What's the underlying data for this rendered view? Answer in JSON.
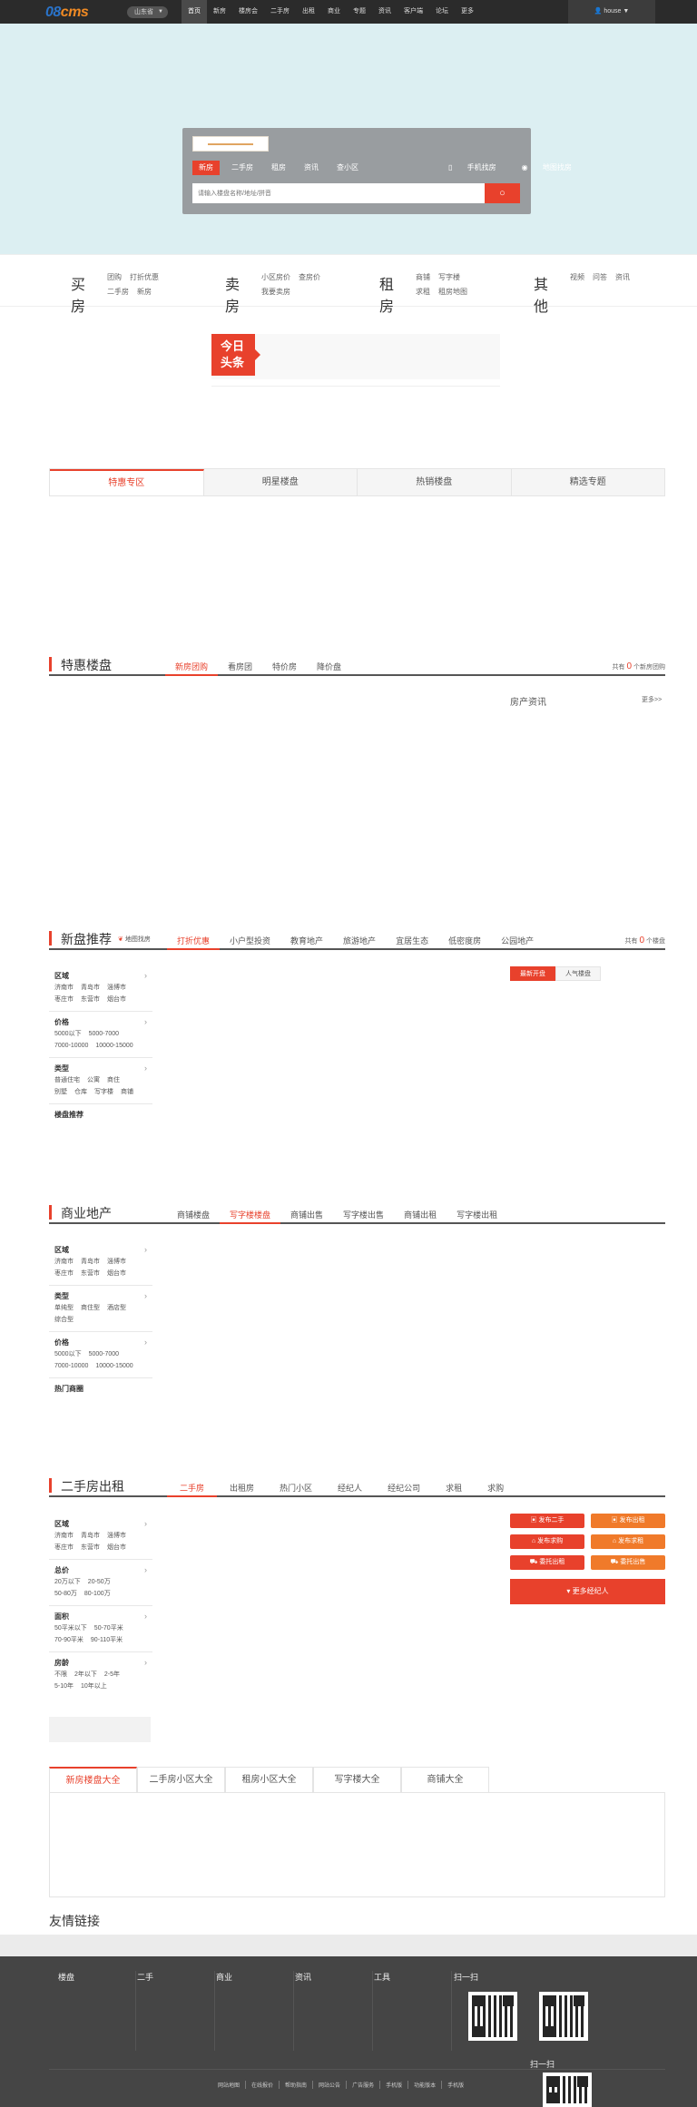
{
  "topbar": {
    "logo_num": "08",
    "logo_text": "cms",
    "city": "山东省",
    "nav": [
      "首页",
      "新房",
      "楼房会",
      "二手房",
      "出租",
      "商业",
      "专题",
      "资讯",
      "客户端",
      "论坛",
      "更多"
    ],
    "user": "house"
  },
  "search": {
    "tabs": [
      "新房",
      "二手房",
      "租房",
      "资讯",
      "查小区"
    ],
    "mobile_link": "手机找房",
    "map_link": "地图找房",
    "placeholder": "请输入楼盘名称/地址/拼音",
    "button_icon": "search-icon"
  },
  "categories": [
    {
      "name": "买房",
      "links": [
        "团购",
        "打折优惠",
        "二手房",
        "新房"
      ]
    },
    {
      "name": "卖房",
      "links": [
        "小区房价",
        "查房价",
        "我要卖房"
      ]
    },
    {
      "name": "租房",
      "links": [
        "商铺",
        "写字楼",
        "求租",
        "租房地图"
      ]
    },
    {
      "name": "其他",
      "links": [
        "视频",
        "问答",
        "资讯"
      ]
    }
  ],
  "headline": {
    "tag": "今日头条"
  },
  "zone_tabs": [
    "特惠专区",
    "明星楼盘",
    "热销楼盘",
    "精选专题"
  ],
  "special": {
    "title": "特惠楼盘",
    "tabs": [
      "新房团购",
      "看房团",
      "特价房",
      "降价盘"
    ],
    "count_prefix": "共有",
    "count": "0",
    "count_suffix": "个新房团购",
    "news_title": "房产资讯",
    "news_more": "更多>>"
  },
  "newhomes": {
    "title": "新盘推荐",
    "map_search": "地图找房",
    "tabs": [
      "打折优惠",
      "小户型投资",
      "教育地产",
      "旅游地产",
      "宜居生态",
      "低密度房",
      "公园地产"
    ],
    "count_prefix": "共有",
    "count": "0",
    "count_suffix": "个楼盘",
    "filters": [
      {
        "title": "区域",
        "items": [
          "济南市",
          "青岛市",
          "淄博市",
          "枣庄市",
          "东营市",
          "烟台市"
        ]
      },
      {
        "title": "价格",
        "items": [
          "5000以下",
          "5000-7000",
          "7000-10000",
          "10000-15000"
        ]
      },
      {
        "title": "类型",
        "items": [
          "普通住宅",
          "公寓",
          "商住",
          "别墅",
          "仓库",
          "写字楼",
          "商铺"
        ]
      },
      {
        "title": "楼盘推荐",
        "items": []
      }
    ],
    "side_tabs": [
      "最新开盘",
      "人气楼盘"
    ]
  },
  "commercial": {
    "title": "商业地产",
    "tabs": [
      "商铺楼盘",
      "写字楼楼盘",
      "商铺出售",
      "写字楼出售",
      "商铺出租",
      "写字楼出租"
    ],
    "filters": [
      {
        "title": "区域",
        "items": [
          "济南市",
          "青岛市",
          "淄博市",
          "枣庄市",
          "东营市",
          "烟台市"
        ]
      },
      {
        "title": "类型",
        "items": [
          "单纯型",
          "商住型",
          "酒店型",
          "综合型"
        ]
      },
      {
        "title": "价格",
        "items": [
          "5000以下",
          "5000-7000",
          "7000-10000",
          "10000-15000"
        ]
      },
      {
        "title": "热门商圈",
        "items": []
      }
    ]
  },
  "secondhand": {
    "title": "二手房出租",
    "tabs": [
      "二手房",
      "出租房",
      "热门小区",
      "经纪人",
      "经纪公司",
      "求租",
      "求购"
    ],
    "filters": [
      {
        "title": "区域",
        "items": [
          "济南市",
          "青岛市",
          "淄博市",
          "枣庄市",
          "东营市",
          "烟台市"
        ]
      },
      {
        "title": "总价",
        "items": [
          "20万以下",
          "20-50万",
          "50-80万",
          "80-100万"
        ]
      },
      {
        "title": "面积",
        "items": [
          "50平米以下",
          "50-70平米",
          "70-90平米",
          "90-110平米"
        ]
      },
      {
        "title": "房龄",
        "items": [
          "不限",
          "2年以下",
          "2-5年",
          "5-10年",
          "10年以上"
        ]
      }
    ],
    "actions": [
      "发布二手",
      "发布出租",
      "发布求购",
      "发布求租",
      "委托出租",
      "委托出售"
    ],
    "agent_button": "更多经纪人"
  },
  "bottom_tabs": [
    "新房楼盘大全",
    "二手房小区大全",
    "租房小区大全",
    "写字楼大全",
    "商铺大全"
  ],
  "friend_links": "友情链接",
  "footer": {
    "cols": [
      "楼盘",
      "二手",
      "商业",
      "资讯",
      "工具"
    ],
    "scan": "扫一扫",
    "links": [
      "网站地图",
      "在线报价",
      "帮助指南",
      "网站公告",
      "广告服务",
      "手机版",
      "功能版本",
      "手机版"
    ]
  },
  "colors": {
    "accent": "#e8412c",
    "topbar": "#2b2b2b",
    "hero": "#dceff2",
    "footer": "#454545"
  }
}
